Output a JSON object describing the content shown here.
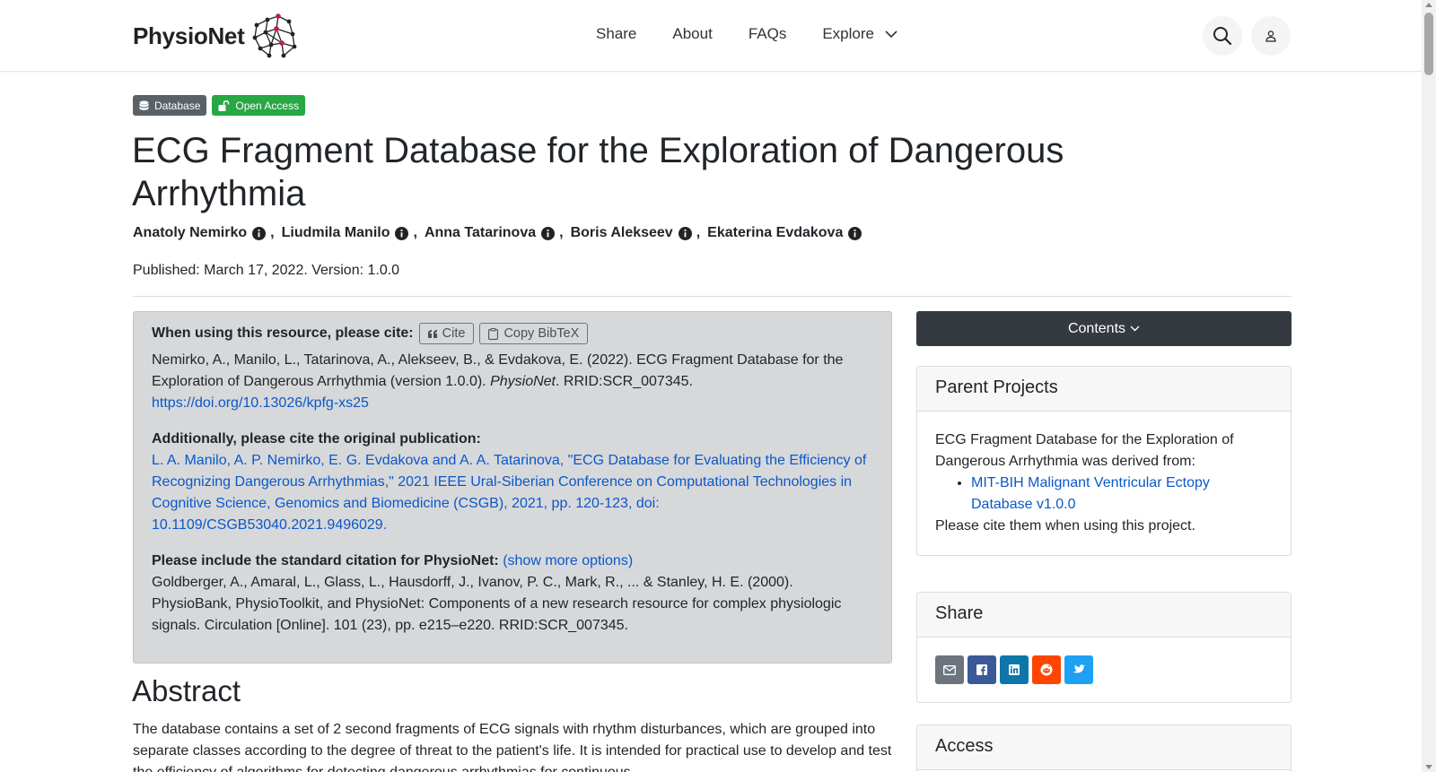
{
  "header": {
    "logo_text": "PhysioNet",
    "nav": [
      {
        "label": "Share"
      },
      {
        "label": "About"
      },
      {
        "label": "FAQs"
      },
      {
        "label": "Explore"
      }
    ],
    "search_icon": "search-icon",
    "user_icon": "user-icon"
  },
  "badges": {
    "database": "Database",
    "open_access": "Open Access"
  },
  "project": {
    "title": "ECG Fragment Database for the Exploration of Dangerous Arrhythmia",
    "authors": [
      "Anatoly Nemirko",
      "Liudmila Manilo",
      "Anna Tatarinova",
      "Boris Alekseev",
      "Ekaterina Evdakova"
    ],
    "published": "Published: March 17, 2022. Version: 1.0.0"
  },
  "cite": {
    "heading": "When using this resource, please cite:",
    "cite_button": "Cite",
    "bibtex_button": "Copy BibTeX",
    "citation_text": "Nemirko, A., Manilo, L., Tatarinova, A., Alekseev, B., & Evdakova, E. (2022). ECG Fragment Database for the Exploration of Dangerous Arrhythmia (version 1.0.0).",
    "citation_journal": "PhysioNet",
    "citation_rrid": ". RRID:SCR_007345.",
    "citation_doi": "https://doi.org/10.13026/kpfg-xs25",
    "original_heading": "Additionally, please cite the original publication:",
    "original_link": "L. A. Manilo, A. P. Nemirko, E. G. Evdakova and A. A. Tatarinova, \"ECG Database for Evaluating the Efficiency of Recognizing Dangerous Arrhythmias,\" 2021 IEEE Ural-Siberian Conference on Computational Technologies in Cognitive Science, Genomics and Biomedicine (CSGB), 2021, pp. 120-123, doi: 10.1109/CSGB53040.2021.9496029.",
    "standard_heading": "Please include the standard citation for PhysioNet:",
    "show_more": "(show more options)",
    "standard_text": "Goldberger, A., Amaral, L., Glass, L., Hausdorff, J., Ivanov, P. C., Mark, R., ... & Stanley, H. E. (2000). PhysioBank, PhysioToolkit, and PhysioNet: Components of a new research resource for complex physiologic signals. Circulation [Online]. 101 (23), pp. e215–e220. RRID:SCR_007345."
  },
  "abstract": {
    "heading": "Abstract",
    "text": "The database contains a set of 2 second fragments of ECG signals with rhythm disturbances, which are grouped into separate classes according to the degree of threat to the patient's life. It is intended for practical use to develop and test the efficiency of algorithms for detecting dangerous arrhythmias for continuous"
  },
  "sidebar": {
    "contents_label": "Contents",
    "parent_projects": {
      "title": "Parent Projects",
      "intro": "ECG Fragment Database for the Exploration of Dangerous Arrhythmia was derived from:",
      "link": "MIT-BIH Malignant Ventricular Ectopy Database v1.0.0",
      "note": "Please cite them when using this project."
    },
    "share": {
      "title": "Share",
      "buttons": [
        {
          "icon": "envelope-icon",
          "color": "#6c757d"
        },
        {
          "icon": "facebook-icon",
          "color": "#3b5998"
        },
        {
          "icon": "linkedin-icon",
          "color": "#0e76a8"
        },
        {
          "icon": "reddit-icon",
          "color": "#ff4500"
        },
        {
          "icon": "twitter-icon",
          "color": "#1da1f2"
        }
      ]
    },
    "access": {
      "title": "Access"
    }
  }
}
